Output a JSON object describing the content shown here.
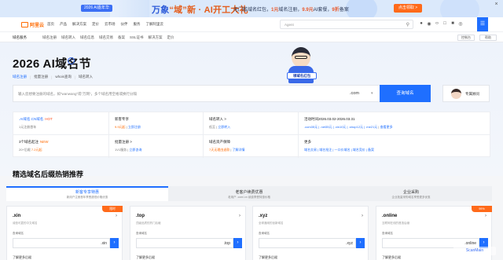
{
  "promo": {
    "badge": "2026 AI嘉年华",
    "headline_part1": "万象",
    "headline_part2": "“域”新 · AI开工大礼",
    "sub_pre": "无门槛域名红包，",
    "sub_hl1": "1元",
    "sub_mid": "域名注册，",
    "sub_hl2": "9.9元",
    "sub_mid2": "AI套餐，",
    "sub_hl3": "9折",
    "sub_post": "备案",
    "cta": "点击领取 >",
    "close": "×"
  },
  "header": {
    "logo_text": "阿里云",
    "nav": [
      "首页",
      "产品",
      "解决方案",
      "定价",
      "云市场",
      "伙伴",
      "服务",
      "了解阿里云"
    ],
    "search_placeholder": "Agent",
    "search_icon": "search-icon",
    "icons": [
      "bell-icon",
      "globe-icon",
      "code-icon",
      "doc-icon",
      "cart-icon",
      "user-icon"
    ],
    "blue_btn_icon": "menu-icon"
  },
  "subnav": {
    "title": "域名服务",
    "items": [
      "域名注册",
      "域名转入",
      "域名信息",
      "域名交易",
      "备案",
      "SSL证书",
      "解决方案",
      "定价"
    ],
    "right_btn1": "控制台",
    "right_btn2": "帮助"
  },
  "hero": {
    "title": "2026 AI域名节",
    "title_icon": "info-icon",
    "links": [
      "域名注册",
      "批量注册",
      "whois查询",
      "域名转入"
    ],
    "mascot_sign": "领域名红包",
    "search_placeholder": "输入您想要注册的域名，如“wanwang”或“万网”，多个域名用空格或换行分隔",
    "tld": ".com",
    "search_button": "查询域名",
    "agent_label": "专属顾问"
  },
  "grid": [
    {
      "title": ".AI域名.CN域名",
      "tag": "HOT",
      "tag_type": "hot",
      "desc_pre": "1元注册首年",
      "desc_link": "",
      "desc_post": ""
    },
    {
      "title": "新客专享",
      "desc_pre": "",
      "desc_org": "9.9元起",
      "desc_link": "立即注册"
    },
    {
      "title": "域名转入 >",
      "desc_pre": "低至",
      "desc_org": "",
      "desc_link": "立即转入"
    },
    {
      "title": "活动时间2026.03.02-2026.03.31",
      "desc_pre": "",
      "desc_org": ".com35元 | .net35元 | .xin10元 | .shop12元 | .me21元",
      "desc_link": "查看更多"
    },
    {
      "title": "3个域名起注",
      "tag": "NEW",
      "tag_type": "new",
      "desc_pre": "20+后缀",
      "desc_org": "7.2元起",
      "desc_link": ""
    },
    {
      "title": "批量注册 >",
      "desc_pre": "1V1服务",
      "desc_org": "",
      "desc_link": "立即咨询"
    },
    {
      "title": "域名资产保障",
      "desc_pre": "",
      "desc_org": "7天无理由退款",
      "desc_link": "了解详情"
    },
    {
      "title": "更多",
      "desc_pre": "",
      "desc_org": "",
      "desc_link": "域名交易 | 域名抢注 | 一口价域名 | 域名竞价 | 备案"
    }
  ],
  "section_title": "精选域名后缀热销推荐",
  "tabs": [
    {
      "label": "新客专享特惠",
      "sub": "新用户注册首年享受超低价格优惠"
    },
    {
      "label": "老客户续费优惠",
      "sub": "老用户 .com/.cn 续费享受特惠价格"
    },
    {
      "label": "企业采购",
      "sub": "企业批量采购域名享受更多优惠"
    }
  ],
  "cards": [
    {
      "name": ".xin",
      "desc": "诚信可靠的中文域名",
      "label": "查询域名",
      "suffix": ".xin",
      "more": "了解更多后缀",
      "tag": "限时"
    },
    {
      "name": ".top",
      "desc": "顶级品质的热门后缀",
      "label": "查询域名",
      "suffix": ".top",
      "more": "了解更多后缀",
      "tag": ""
    },
    {
      "name": ".xyz",
      "desc": "全球通用的创新域名",
      "label": "查询域名",
      "suffix": ".xyz",
      "more": "了解更多后缀",
      "tag": ""
    },
    {
      "name": ".online",
      "desc": "互联网在线的首选后缀",
      "label": "查询域名",
      "suffix": ".online",
      "more": "了解更多后缀",
      "tag": "99%"
    }
  ],
  "watermark": "ScanMain"
}
